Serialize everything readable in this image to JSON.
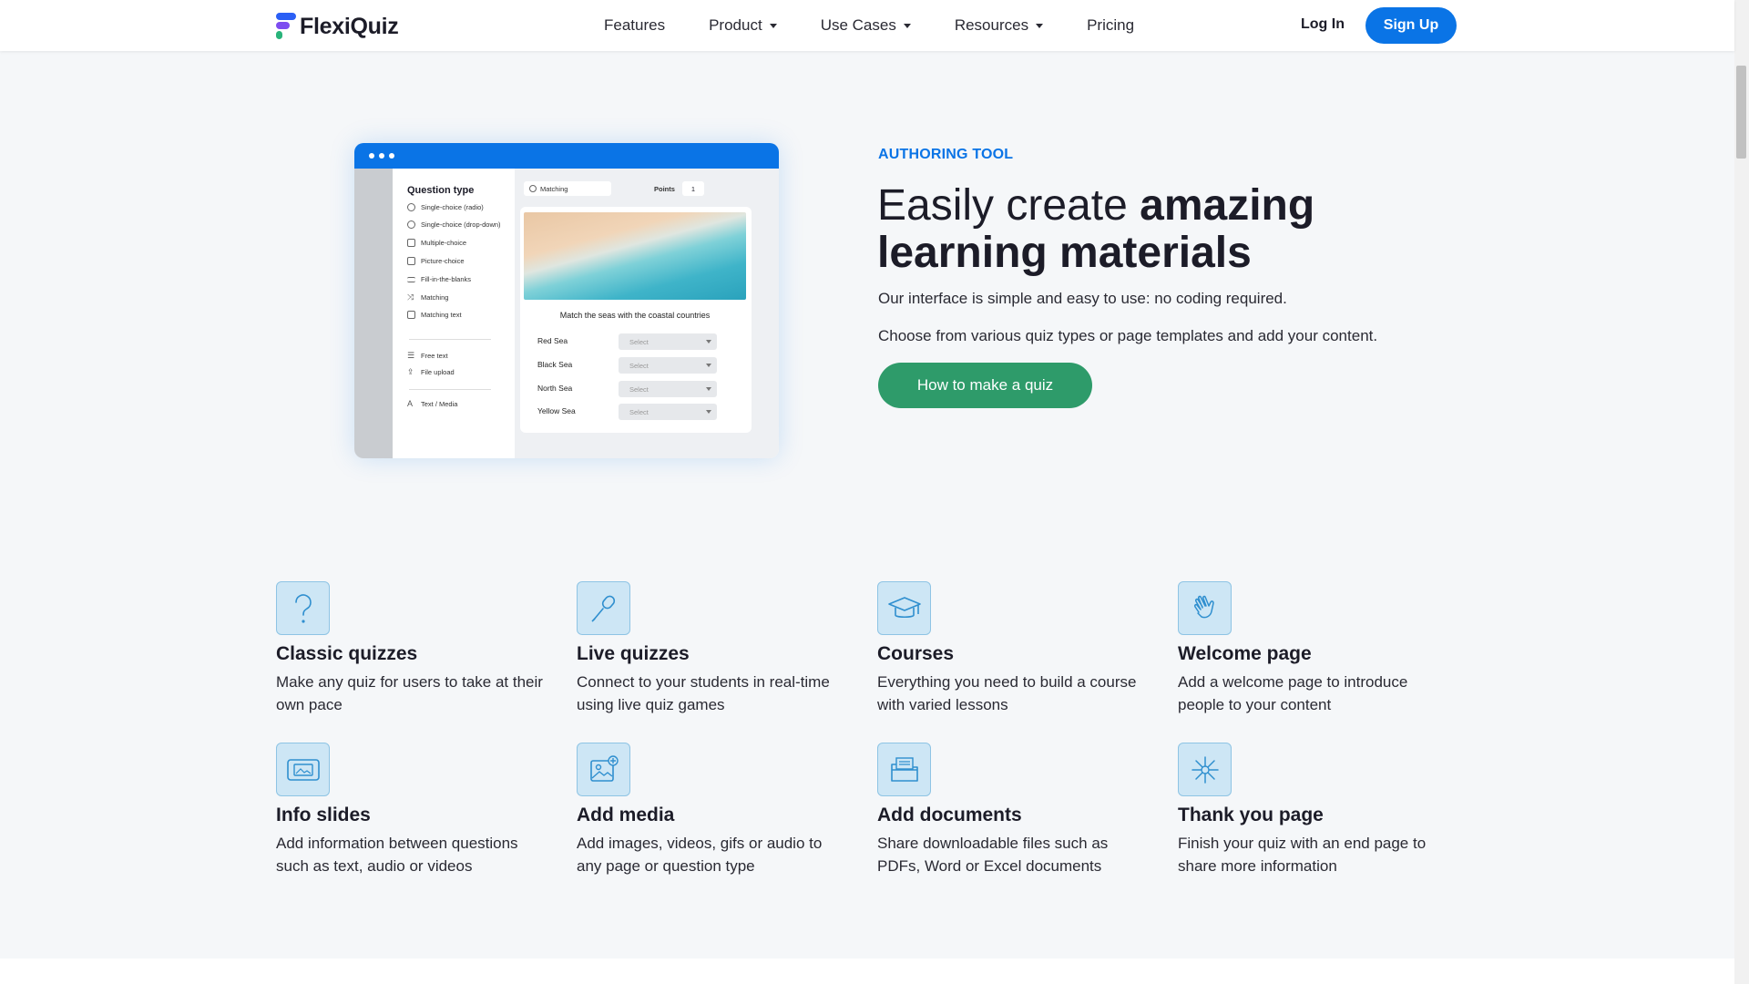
{
  "brand": {
    "name": "FlexiQuiz"
  },
  "nav": {
    "links": [
      {
        "label": "Features",
        "dropdown": false
      },
      {
        "label": "Product",
        "dropdown": true
      },
      {
        "label": "Use Cases",
        "dropdown": true
      },
      {
        "label": "Resources",
        "dropdown": true
      },
      {
        "label": "Pricing",
        "dropdown": false
      }
    ],
    "login_label": "Log In",
    "signup_label": "Sign Up"
  },
  "mockup": {
    "question_type_title": "Question type",
    "question_types": [
      {
        "label": "Single-choice (radio)",
        "icon": "radio-icon"
      },
      {
        "label": "Single-choice (drop-down)",
        "icon": "dropdown-icon"
      },
      {
        "label": "Multiple-choice",
        "icon": "checkbox-icon"
      },
      {
        "label": "Picture-choice",
        "icon": "image-icon"
      },
      {
        "label": "Fill-in-the-blanks",
        "icon": "blanks-icon"
      },
      {
        "label": "Matching",
        "icon": "shuffle-icon"
      },
      {
        "label": "Matching text",
        "icon": "grid-icon"
      }
    ],
    "extra_types": [
      {
        "label": "Free text",
        "icon": "lines-icon"
      },
      {
        "label": "File upload",
        "icon": "upload-icon"
      }
    ],
    "media_type": {
      "label": "Text / Media",
      "icon": "text-media-icon"
    },
    "selected_type": "Matching",
    "points_label": "Points",
    "points_value": "1",
    "question_text": "Match the seas with the coastal countries",
    "rows": [
      {
        "label": "Red Sea",
        "select": "Select"
      },
      {
        "label": "Black Sea",
        "select": "Select"
      },
      {
        "label": "North Sea",
        "select": "Select"
      },
      {
        "label": "Yellow Sea",
        "select": "Select"
      }
    ]
  },
  "hero": {
    "eyebrow": "AUTHORING TOOL",
    "headline_light": "Easily create ",
    "headline_bold": "amazing learning materials",
    "paragraph1": "Our interface is simple and easy to use: no coding required.",
    "paragraph2": "Choose from various quiz types or page templates and add your content.",
    "cta_label": "How to make a quiz"
  },
  "features": [
    {
      "icon": "question-mark-icon",
      "title": "Classic quizzes",
      "desc": "Make any quiz for users to take at their own pace"
    },
    {
      "icon": "microphone-icon",
      "title": "Live quizzes",
      "desc": "Connect to your students in real-time using live quiz games"
    },
    {
      "icon": "graduation-cap-icon",
      "title": "Courses",
      "desc": "Everything you need to build a course with varied lessons"
    },
    {
      "icon": "waving-hand-icon",
      "title": "Welcome page",
      "desc": "Add a welcome page to introduce people to your content"
    },
    {
      "icon": "info-slide-icon",
      "title": "Info slides",
      "desc": "Add information between questions such as text, audio or videos"
    },
    {
      "icon": "add-image-icon",
      "title": "Add media",
      "desc": "Add images, videos, gifs or audio to any page or question type"
    },
    {
      "icon": "document-folder-icon",
      "title": "Add documents",
      "desc": "Share downloadable files such as PDFs, Word or Excel documents"
    },
    {
      "icon": "sparkle-icon",
      "title": "Thank you page",
      "desc": "Finish your quiz with an end page to share more information"
    }
  ],
  "colors": {
    "primary_blue": "#0a74e6",
    "cta_green": "#2e9b6a",
    "icon_tile": "#cde6f5",
    "page_bg": "#f5f7f9"
  }
}
